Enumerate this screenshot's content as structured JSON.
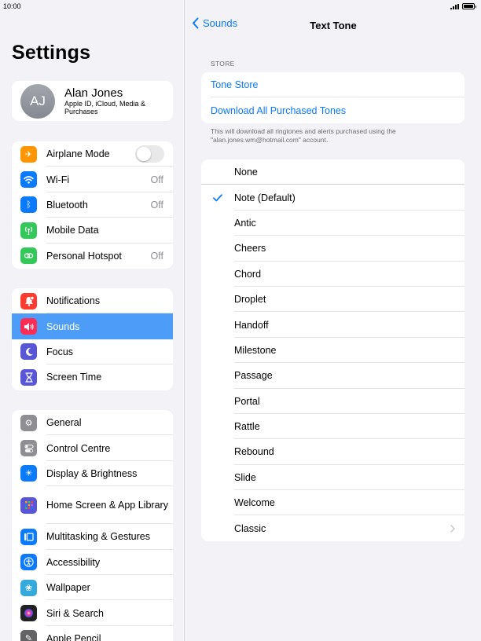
{
  "status": {
    "time": "10:00"
  },
  "left": {
    "title": "Settings",
    "profile": {
      "initials": "AJ",
      "name": "Alan Jones",
      "subtitle": "Apple ID, iCloud, Media & Purchases"
    },
    "group1": [
      {
        "label": "Airplane Mode",
        "icon": "airplane-icon",
        "color": "#ff9500",
        "value": "",
        "toggle": true
      },
      {
        "label": "Wi-Fi",
        "icon": "wifi-icon",
        "color": "#0a7aff",
        "value": "Off"
      },
      {
        "label": "Bluetooth",
        "icon": "bluetooth-icon",
        "color": "#0a7aff",
        "value": "Off"
      },
      {
        "label": "Mobile Data",
        "icon": "antenna-icon",
        "color": "#34c759",
        "value": ""
      },
      {
        "label": "Personal Hotspot",
        "icon": "hotspot-icon",
        "color": "#34c759",
        "value": "Off"
      }
    ],
    "group2": [
      {
        "label": "Notifications",
        "icon": "bell-icon",
        "color": "#ff3b30"
      },
      {
        "label": "Sounds",
        "icon": "speaker-icon",
        "color": "#ff2d55",
        "selected": true
      },
      {
        "label": "Focus",
        "icon": "moon-icon",
        "color": "#5856d6"
      },
      {
        "label": "Screen Time",
        "icon": "hourglass-icon",
        "color": "#5856d6"
      }
    ],
    "group3": [
      {
        "label": "General",
        "icon": "gear-icon",
        "color": "#8e8e93"
      },
      {
        "label": "Control Centre",
        "icon": "toggles-icon",
        "color": "#8e8e93"
      },
      {
        "label": "Display & Brightness",
        "icon": "sun-icon",
        "color": "#0a7aff"
      },
      {
        "label": "Home Screen & App Library",
        "icon": "grid-icon",
        "color": "#5856d6",
        "tall": true
      },
      {
        "label": "Multitasking & Gestures",
        "icon": "multitasking-icon",
        "color": "#0a7aff"
      },
      {
        "label": "Accessibility",
        "icon": "accessibility-icon",
        "color": "#0a7aff"
      },
      {
        "label": "Wallpaper",
        "icon": "flower-icon",
        "color": "#34aadc"
      },
      {
        "label": "Siri & Search",
        "icon": "siri-icon",
        "color": "#222222"
      },
      {
        "label": "Apple Pencil",
        "icon": "pencil-icon",
        "color": "#636366"
      }
    ]
  },
  "right": {
    "back_label": "Sounds",
    "title": "Text Tone",
    "store_header": "STORE",
    "store_items": [
      "Tone Store",
      "Download All Purchased Tones"
    ],
    "store_footer": "This will download all ringtones and alerts purchased using the \"alan.jones.wm@hotmail.com\" account.",
    "tones": [
      {
        "label": "None"
      },
      {
        "label": "Note (Default)",
        "checked": true
      },
      {
        "label": "Antic"
      },
      {
        "label": "Cheers"
      },
      {
        "label": "Chord"
      },
      {
        "label": "Droplet"
      },
      {
        "label": "Handoff"
      },
      {
        "label": "Milestone"
      },
      {
        "label": "Passage"
      },
      {
        "label": "Portal"
      },
      {
        "label": "Rattle"
      },
      {
        "label": "Rebound"
      },
      {
        "label": "Slide"
      },
      {
        "label": "Welcome"
      },
      {
        "label": "Classic",
        "chevron": true
      }
    ]
  }
}
